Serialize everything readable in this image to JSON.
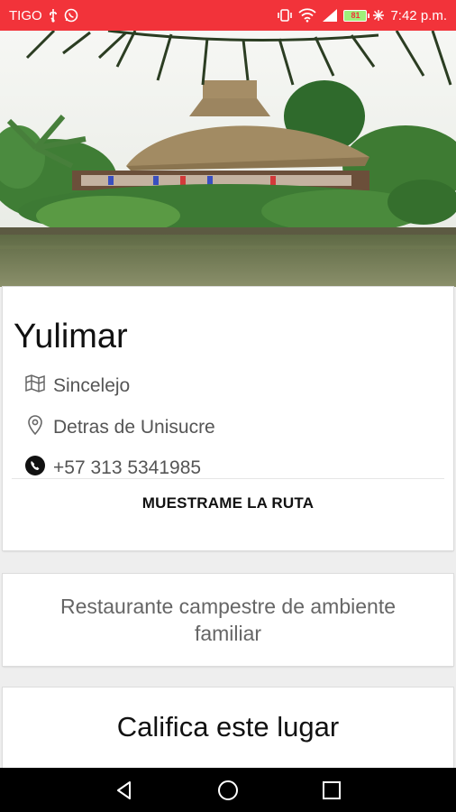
{
  "status_bar": {
    "carrier": "TIGO",
    "battery_level": "81",
    "time": "7:42 p.m.",
    "icons": [
      "usb-icon",
      "whatsapp-icon",
      "vibrate-icon",
      "wifi-icon",
      "signal-icon",
      "battery-icon"
    ]
  },
  "hero": {
    "icon": "photo-hut-on-river"
  },
  "place": {
    "name": "Yulimar",
    "city": "Sincelejo",
    "address": "Detras de Unisucre",
    "phone": "+57 313 5341985",
    "route_button": "MUESTRAME LA RUTA"
  },
  "description": "Restaurante campestre de ambiente familiar",
  "rating": {
    "title": "Califica este lugar"
  },
  "nav": {
    "icons": [
      "back-icon",
      "home-icon",
      "recents-icon"
    ]
  },
  "colors": {
    "status_bar": "#f2333a",
    "nav_bar": "#000000"
  }
}
